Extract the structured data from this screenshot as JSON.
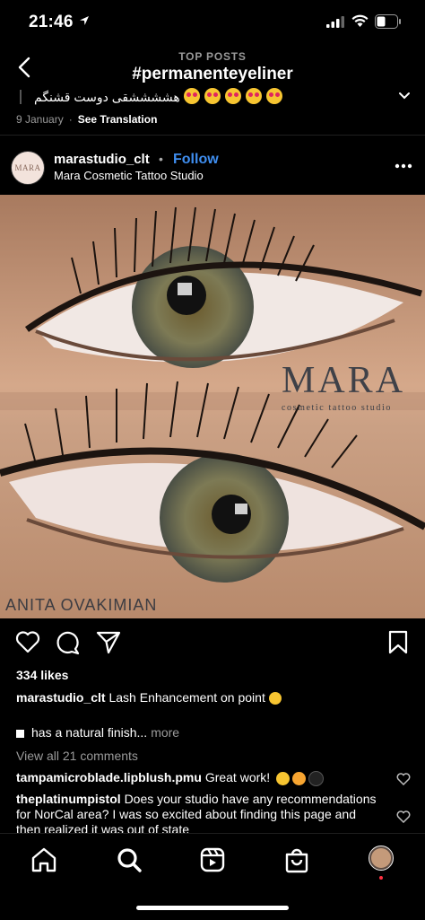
{
  "status": {
    "time": "21:46"
  },
  "nav": {
    "supertitle": "TOP POSTS",
    "title": "#permanenteyeliner"
  },
  "previous_post": {
    "caption": "هششششقی دوست قشنگم",
    "date": "9 January",
    "separator": "·",
    "see_translation": "See Translation"
  },
  "post": {
    "username": "marastudio_clt",
    "separator": "•",
    "follow_label": "Follow",
    "subtitle": "Mara Cosmetic Tattoo Studio",
    "avatar_text": "MARA",
    "watermark": {
      "brand": "MARA",
      "tagline": "cosmetic tattoo studio",
      "artist": "ANITA OVAKIMIAN"
    },
    "likes": "334 likes",
    "caption_user": "marastudio_clt",
    "caption_text": "Lash Enhancement on point",
    "caption_line2": "has a natural finish...",
    "caption_more": "more",
    "view_all": "View all 21 comments",
    "comments": [
      {
        "user": "tampamicroblade.lipblush.pmu",
        "text": "Great work!"
      },
      {
        "user": "theplatinumpistol",
        "text": "Does your studio have any recommendations for NorCal area?  I was so excited about finding this page and then realized it was out of state"
      }
    ]
  },
  "icons": [
    "back-icon",
    "chevron-down-icon",
    "more-icon",
    "heart-icon",
    "comment-icon",
    "share-icon",
    "bookmark-icon",
    "home-icon",
    "search-icon",
    "reels-icon",
    "shop-icon"
  ],
  "colors": {
    "background": "#000000",
    "follow": "#3f8ef0",
    "muted": "#9a9a9a"
  }
}
